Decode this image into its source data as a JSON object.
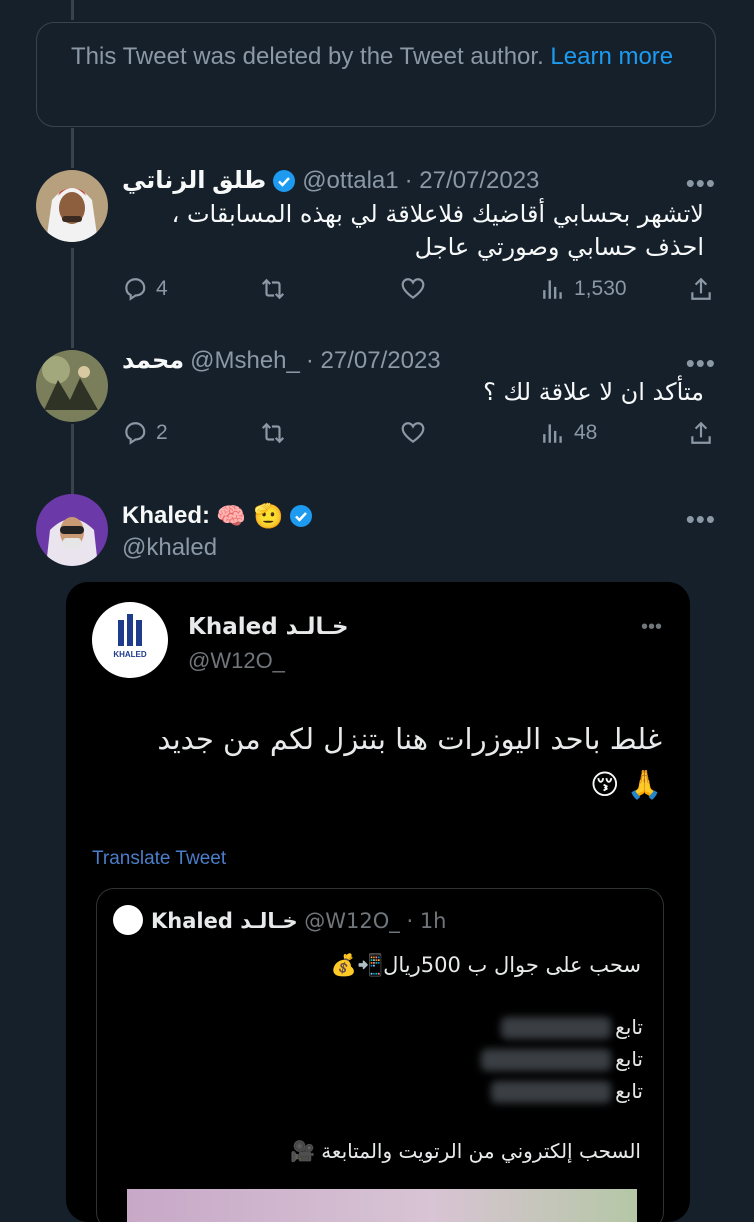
{
  "deleted_notice": {
    "text": "This Tweet was deleted by the Tweet author.",
    "link": "Learn more"
  },
  "reply1": {
    "name": "طلق الزناتي",
    "handle": "@ottala1",
    "date": "· 27/07/2023",
    "text": "لاتشهر بحسابي أقاضيك فلاعلاقة لي بهذه المسابقات ، احذف حسابي وصورتي عاجل",
    "replies": "4",
    "views": "1,530"
  },
  "reply2": {
    "name": "محمد",
    "handle": "@Msheh_",
    "date": "· 27/07/2023",
    "text": "متأكد ان لا علاقة لك ؟",
    "replies": "2",
    "views": "48"
  },
  "main": {
    "name": "Khaled:",
    "emojis": "🧠 🫡",
    "handle": "@khaled"
  },
  "screenshot": {
    "name": "Khaled خـالـد",
    "handle": "@W12O_",
    "text_line1": "غلط باحد اليوزرات هنا بتنزل لكم من جديد",
    "text_line2": "😚 🙏",
    "translate": "Translate Tweet",
    "logo_text": "KHALED",
    "quote": {
      "name": "Khaled خـالـد",
      "handle": "@W12O_ · 1h",
      "line1": "سحب على  جوال ب 500ريال📲💰",
      "follow": "تابع",
      "line_last": "السحب إلكتروني من الرتويت والمتابعة 🎥"
    }
  },
  "colors": {
    "bg": "#15202b",
    "accent": "#1d9bf0",
    "muted": "#8b98a5",
    "border": "#38444d"
  }
}
